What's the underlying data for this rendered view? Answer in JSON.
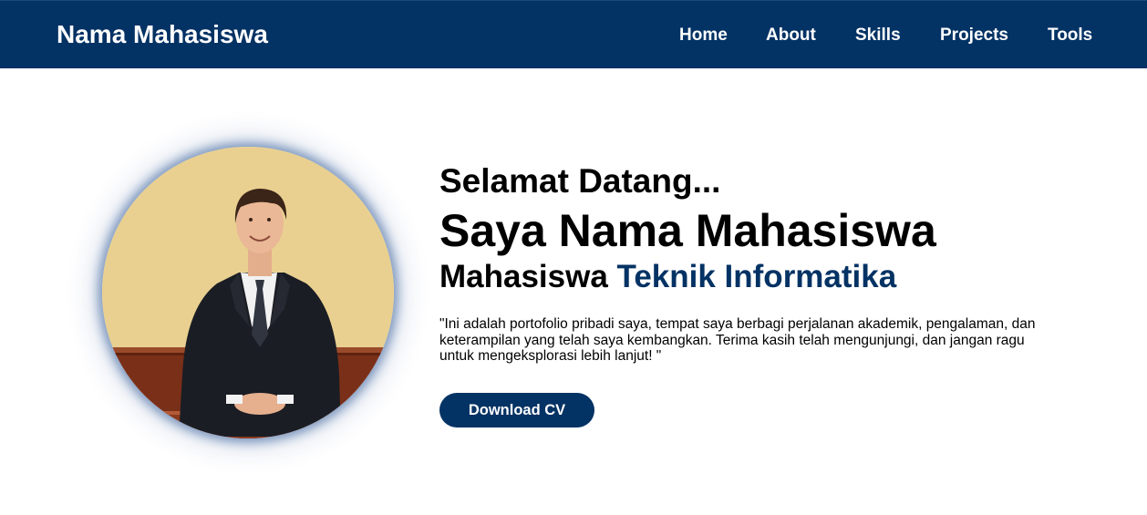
{
  "navbar": {
    "brand": "Nama Mahasiswa",
    "links": [
      {
        "label": "Home"
      },
      {
        "label": "About"
      },
      {
        "label": "Skills"
      },
      {
        "label": "Projects"
      },
      {
        "label": "Tools"
      }
    ]
  },
  "hero": {
    "welcome": "Selamat Datang...",
    "name_line": "Saya Nama Mahasiswa",
    "role_prefix": "Mahasiswa",
    "role_highlight": "Teknik Informatika",
    "bio": "\"Ini adalah portofolio pribadi saya, tempat saya berbagi perjalanan akademik, pengalaman, dan keterampilan yang telah saya kembangkan. Terima kasih telah mengunjungi, dan jangan ragu untuk mengeksplorasi lebih lanjut! \"",
    "cv_button": "Download CV"
  },
  "colors": {
    "navbar_bg": "#033264",
    "accent": "#033264",
    "nav_text": "#ffffff",
    "body_text": "#000000"
  }
}
